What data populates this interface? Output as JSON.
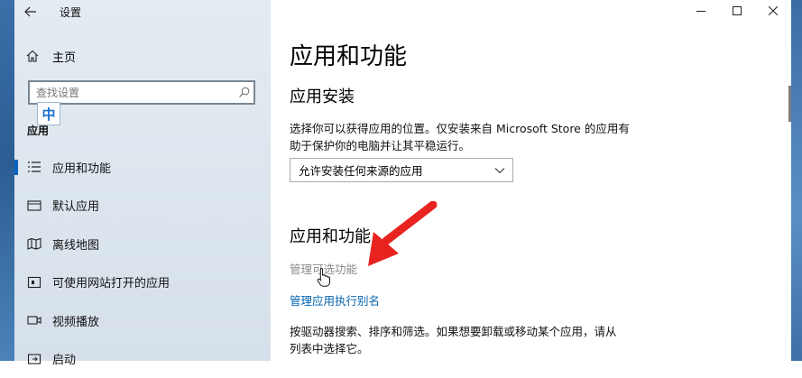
{
  "window": {
    "title": "设置",
    "back_label": "←"
  },
  "sidebar": {
    "home_label": "主页",
    "search_placeholder": "查找设置",
    "ime_indicator": "中",
    "section_title": "应用",
    "items": [
      {
        "label": "应用和功能",
        "icon": "apps-list-icon",
        "active": true
      },
      {
        "label": "默认应用",
        "icon": "default-apps-icon",
        "active": false
      },
      {
        "label": "离线地图",
        "icon": "offline-maps-icon",
        "active": false
      },
      {
        "label": "可使用网站打开的应用",
        "icon": "apps-for-websites-icon",
        "active": false
      },
      {
        "label": "视频播放",
        "icon": "video-playback-icon",
        "active": false
      },
      {
        "label": "启动",
        "icon": "startup-icon",
        "active": false
      }
    ]
  },
  "main": {
    "title": "应用和功能",
    "install_section": {
      "heading": "应用安装",
      "description_line1": "选择你可以获得应用的位置。仅安装来自 Microsoft Store 的应用有",
      "description_line2": "助于保护你的电脑并让其平稳运行。",
      "dropdown_value": "允许安装任何来源的应用"
    },
    "features_section": {
      "heading": "应用和功能",
      "manage_optional_features": "管理可选功能",
      "manage_app_aliases": "管理应用执行别名",
      "description_line1": "按驱动器搜索、排序和筛选。如果想要卸载或移动某个应用，请从",
      "description_line2": "列表中选择它。"
    }
  },
  "colors": {
    "accent": "#0b63c4",
    "link": "#0063b1",
    "annotation_arrow": "#e8231f",
    "sidebar_bg": "#e1e8ef"
  }
}
